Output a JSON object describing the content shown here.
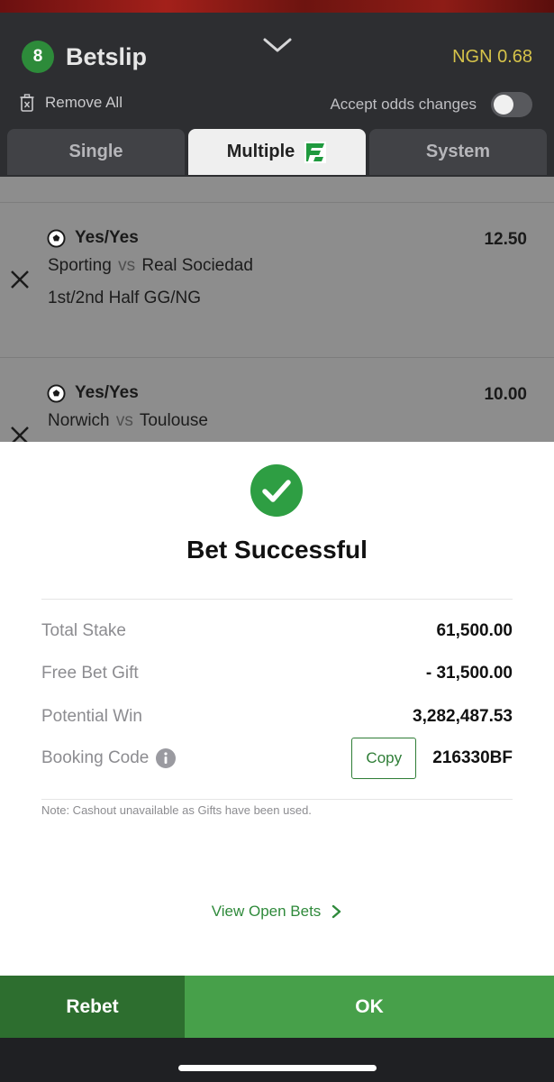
{
  "header": {
    "selection_count": "8",
    "title": "Betslip",
    "balance": "NGN 0.68",
    "remove_all_label": "Remove All",
    "accept_odds_label": "Accept odds changes"
  },
  "tabs": [
    {
      "label": "Single",
      "active": false
    },
    {
      "label": "Multiple",
      "active": true
    },
    {
      "label": "System",
      "active": false
    }
  ],
  "legs": [
    {
      "pick": "Yes/Yes",
      "odds": "12.50",
      "home": "Sporting",
      "vs": "vs",
      "away": "Real Sociedad",
      "market": "1st/2nd Half GG/NG"
    },
    {
      "pick": "Yes/Yes",
      "odds": "10.00",
      "home": "Norwich",
      "vs": "vs",
      "away": "Toulouse"
    }
  ],
  "modal": {
    "title": "Bet Successful",
    "rows": [
      {
        "label": "Total Stake",
        "value": "61,500.00"
      },
      {
        "label": "Free Bet Gift",
        "value": "- 31,500.00"
      },
      {
        "label": "Potential Win",
        "value": "3,282,487.53"
      }
    ],
    "booking": {
      "label": "Booking Code",
      "copy_label": "Copy",
      "code": "216330BF"
    },
    "note": "Note: Cashout unavailable as Gifts have been used.",
    "view_open_bets": "View Open Bets"
  },
  "buttons": {
    "rebet": "Rebet",
    "ok": "OK"
  },
  "colors": {
    "brand_green": "#47a04a",
    "dark_green": "#2d6e2f",
    "balance_yellow": "#d6c34a",
    "header_bg": "#2d2e31"
  },
  "icons": [
    "chevron-down-icon",
    "trash-icon",
    "multiple-logo-icon",
    "close-icon",
    "soccer-ball-icon",
    "check-circle-icon",
    "info-icon",
    "chevron-right-icon"
  ]
}
